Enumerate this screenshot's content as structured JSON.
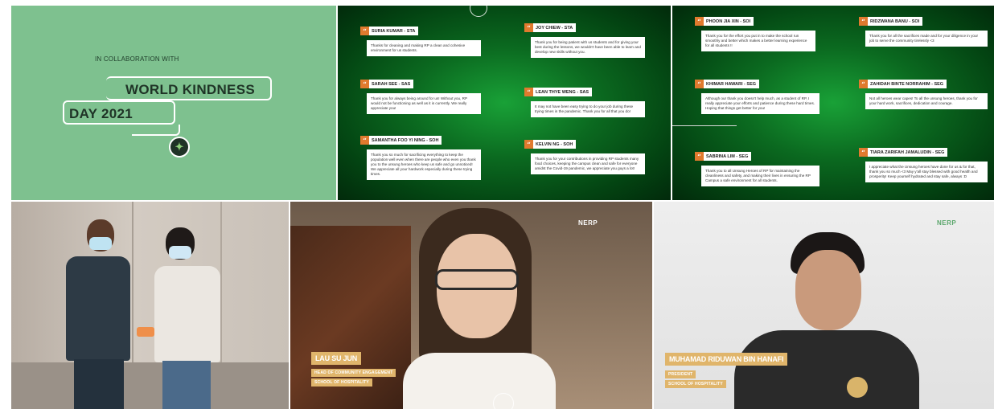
{
  "title_panel": {
    "collab_text": "IN COLLABORATION WITH",
    "title_line1": "WORLD KINDNESS",
    "title_line2": "DAY 2021"
  },
  "messages_left": [
    {
      "name": "SURIA KUMAR - STA",
      "text": "Thanks for cleaning and making RP a clean and cohesive environment for us students."
    },
    {
      "name": "JOY CHIEW - STA",
      "text": "Thank you for being patient with us students and for giving your best during the lessons, we wouldn't have been able to learn and develop new skills without you."
    },
    {
      "name": "SARAH SEE - SAS",
      "text": "Thank you for always being around for us! Without you, RP would not be functioning as well as it is currently. We really appreciate you!"
    },
    {
      "name": "LEAN THYE WENG - SAS",
      "text": "It may not have been easy trying to do your job during these trying times in the pandemic. Thank you for all that you do!"
    },
    {
      "name": "SAMANTHA FOO YI NING - SOH",
      "text": "Thank you so much for sacrificing everything to keep the population well even when there are people who even you thank you to the unsung heroes who keep us safe and go unnoticed! We appreciate all your hardwork especially during these trying times."
    },
    {
      "name": "KELVIN NG - SOH",
      "text": "Thank you for your contributions in providing RP students many food choices, keeping the campus clean and safe for everyone amidst the Covid-19 pandemic, we appreciate you guys a lot!"
    }
  ],
  "messages_right": [
    {
      "name": "PHOON JIA XIN - SOI",
      "text": "Thank you for the effort you put in to make the school run smoothly and better which makes a better learning experience for all students !!"
    },
    {
      "name": "RIDZWANA BANU - SOI",
      "text": "Thank you for all the sacrifices made and for your diligence in your job to serve the community tirelessly <3"
    },
    {
      "name": "KHIMAR HAWARI - SEG",
      "text": "Although our thank you doesn't help much, as a student of RP, I really appreciate your efforts and patience during these hard times. Hoping that things get better for you!"
    },
    {
      "name": "ZAHIDAH BINTE NORRAHIM - SEG",
      "text": "Not all heroes wear capes! To all the unsung heroes, thank you for your hard work, sacrifices, dedication and courage."
    },
    {
      "name": "SABRINA LIM - SEG",
      "text": "Thank you to all Unsung Heroes of RP for maintaining the cleanliness and safety, and making their lives in ensuring the RP Campus a safe environment for all students."
    },
    {
      "name": "TIARA ZARIFAH JAMALUDIN - SEG",
      "text": "I appreciate what the Unsung heroes have done for us & for that, thank you so much <3 May y'all stay blessed with good health and prosperity! Keep yourself hydrated and stay safe, always :D"
    }
  ],
  "video_lau": {
    "name": "LAU SU JUN",
    "role": "HEAD OF COMMUNITY ENGAGEMENT",
    "school": "SCHOOL OF HOSPITALITY",
    "brand": "NERP"
  },
  "video_muhamad": {
    "name": "MUHAMAD RIDUWAN BIN HANAFI",
    "role": "PRESIDENT",
    "school": "SCHOOL OF HOSPITALITY",
    "brand": "NERP"
  },
  "colors": {
    "title_bg": "#7ec18f",
    "accent_orange": "#e07a2e",
    "nametag_gold": "#e0b56b",
    "green_dark": "#034412"
  }
}
